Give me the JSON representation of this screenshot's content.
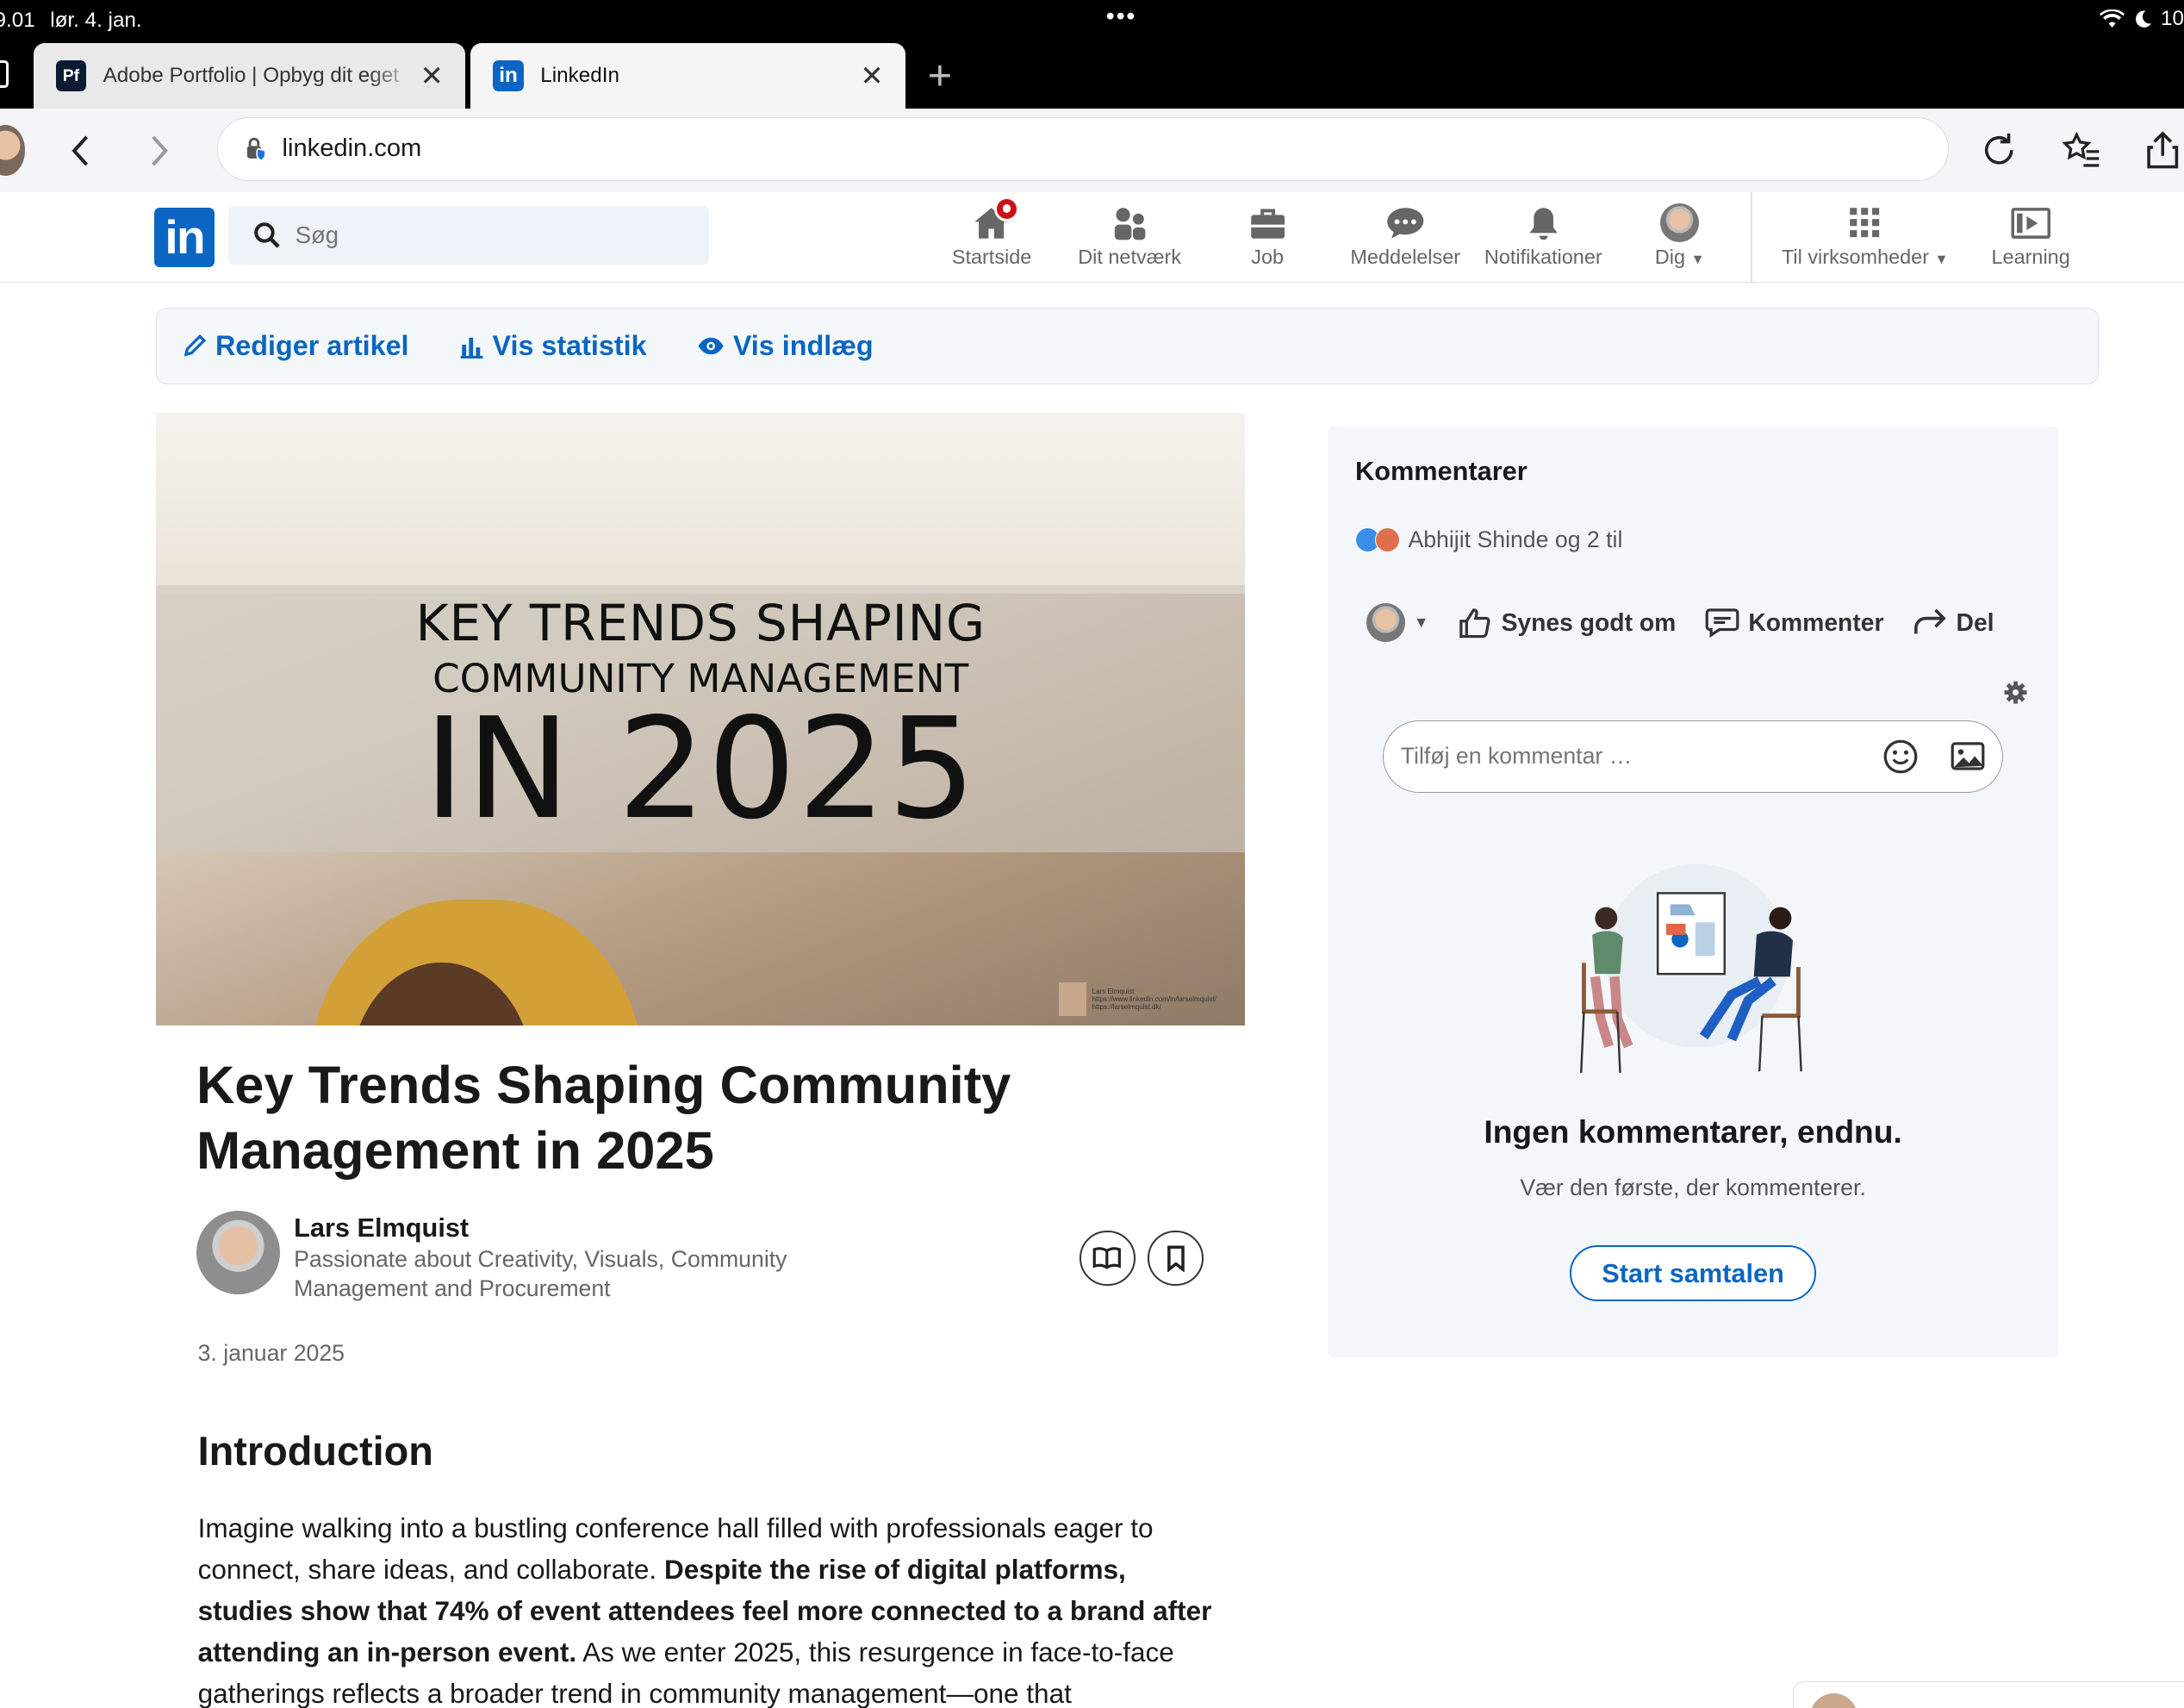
{
  "status_bar": {
    "time": "9.01",
    "date": "lør. 4. jan.",
    "battery": "10"
  },
  "browser": {
    "tabs": [
      {
        "label": "Adobe Portfolio | Opbyg dit eget",
        "favicon": "Pf"
      },
      {
        "label": "LinkedIn",
        "favicon": "in"
      }
    ],
    "url": "linkedin.com"
  },
  "linkedin_nav": {
    "logo": "in",
    "search_placeholder": "Søg",
    "items": [
      {
        "label": "Startside",
        "icon": "home-icon"
      },
      {
        "label": "Dit netværk",
        "icon": "network-icon"
      },
      {
        "label": "Job",
        "icon": "briefcase-icon"
      },
      {
        "label": "Meddelelser",
        "icon": "messaging-icon"
      },
      {
        "label": "Notifikationer",
        "icon": "bell-icon"
      },
      {
        "label": "Dig",
        "icon": "avatar"
      },
      {
        "label": "Til virksomheder",
        "icon": "grid-icon"
      },
      {
        "label": "Learning",
        "icon": "learning-icon"
      }
    ]
  },
  "action_bar": {
    "edit": "Rediger artikel",
    "stats": "Vis statistik",
    "view": "Vis indlæg"
  },
  "hero": {
    "line1": "KEY TRENDS SHAPING",
    "line2": "COMMUNITY MANAGEMENT",
    "line3": "IN 2025",
    "credit_name": "Lars Elmquist",
    "credit_url1": "https://www.linkedin.com/in/larselmquist/",
    "credit_url2": "https://larselmquist.dk/"
  },
  "article": {
    "title": "Key Trends Shaping Community Management in 2025",
    "author_name": "Lars Elmquist",
    "author_headline": "Passionate about Creativity, Visuals, Community Management and Procurement",
    "date": "3. januar 2025",
    "section_heading": "Introduction",
    "para_a": "Imagine walking into a bustling conference hall filled with professionals eager to connect, share ideas, and collaborate. ",
    "para_bold": "Despite the rise of digital platforms, studies show that 74% of event attendees feel more connected to a brand after attending an in-person event.",
    "para_b": " As we enter 2025, this resurgence in face-to-face gatherings reflects a broader trend in community management—one that"
  },
  "comments": {
    "heading": "Kommentarer",
    "reactions": "Abhijit Shinde og 2 til",
    "like": "Synes godt om",
    "comment": "Kommenter",
    "share": "Del",
    "input_placeholder": "Tilføj en kommentar …",
    "empty_title": "Ingen kommentarer, endnu.",
    "empty_sub": "Vær den første, der kommenterer.",
    "start_button": "Start samtalen"
  },
  "colors": {
    "accent": "#0a66c2",
    "badge": "#cc1016"
  }
}
